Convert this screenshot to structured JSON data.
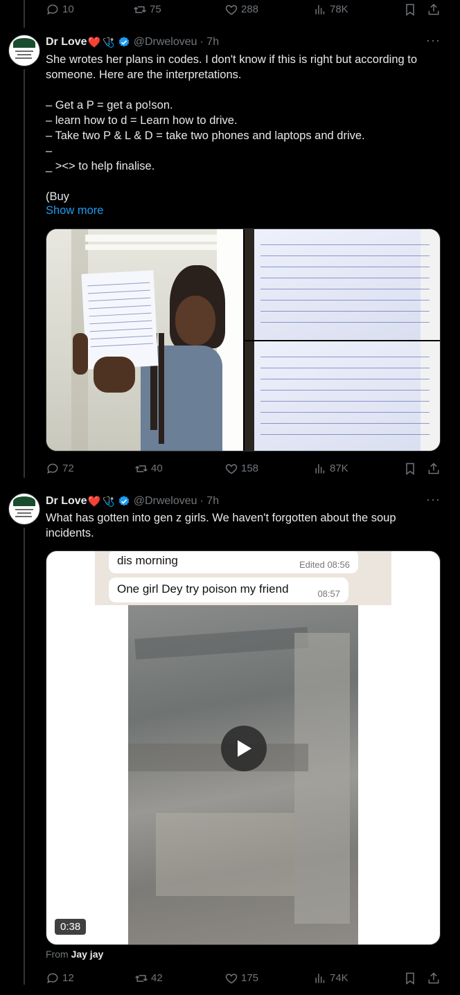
{
  "top_actions": {
    "replies": "10",
    "reposts": "75",
    "likes": "288",
    "views": "78K"
  },
  "tweets": [
    {
      "name": "Dr Love",
      "name_emoji": "❤️",
      "steth": "🩺",
      "handle": "@Drweloveu",
      "time": "· 7h",
      "text": "She wrotes her plans in codes. I don't know if this is right but according to someone. Here are the interpretations.\n\n– Get a P = get a po!son.\n– learn how to d = Learn how to drive.\n– Take two P & L & D = take two phones and laptops and drive.\n–\n_ ><> to help finalise.\n\n(Buy",
      "show_more": "Show more",
      "actions": {
        "replies": "72",
        "reposts": "40",
        "likes": "158",
        "views": "87K"
      }
    },
    {
      "name": "Dr Love",
      "name_emoji": "❤️",
      "steth": "🩺",
      "handle": "@Drweloveu",
      "time": "· 7h",
      "text": "What has gotten into gen z girls. We haven't forgotten about the soup incidents.",
      "video": {
        "bubble1": "dis morning",
        "bubble1_time": "Edited 08:56",
        "bubble2": "One girl Dey try poison my friend",
        "bubble2_time": "08:57",
        "duration": "0:38"
      },
      "from_label": "From",
      "from_name": "Jay jay",
      "actions": {
        "replies": "12",
        "reposts": "42",
        "likes": "175",
        "views": "74K"
      }
    }
  ],
  "colors": {
    "background": "#000000",
    "text": "#e7e9ea",
    "muted": "#71767b",
    "link": "#1d9bf0",
    "verified": "#1d9bf0"
  },
  "icons": [
    "reply-icon",
    "repost-icon",
    "like-icon",
    "views-icon",
    "bookmark-icon",
    "share-icon",
    "verified-icon",
    "more-icon",
    "play-icon"
  ]
}
